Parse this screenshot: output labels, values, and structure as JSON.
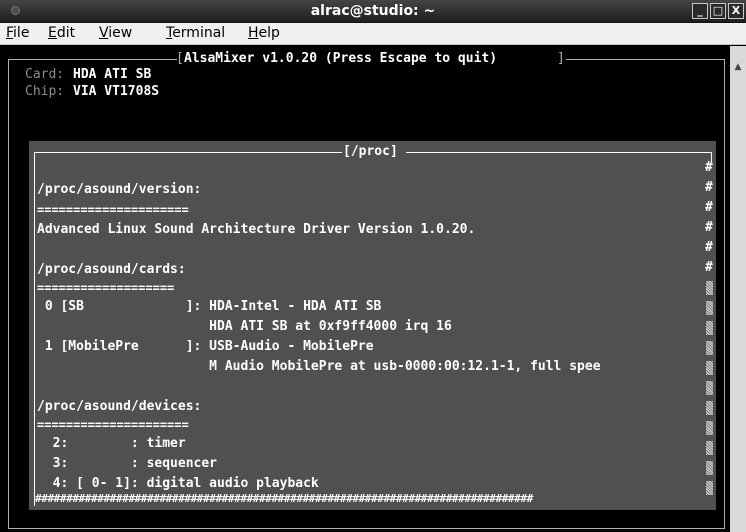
{
  "window": {
    "title": "alrac@studio: ~",
    "minimize": "_",
    "maximize": "□",
    "close": "X"
  },
  "menu": [
    {
      "first": "F",
      "rest": "ile"
    },
    {
      "first": "E",
      "rest": "dit"
    },
    {
      "first": "V",
      "rest": "iew"
    },
    {
      "first": "T",
      "rest": "erminal"
    },
    {
      "first": "H",
      "rest": "elp"
    }
  ],
  "mixer": {
    "header": "AlsaMixer v1.0.20 (Press Escape to quit)",
    "card_label": "Card:",
    "card_value": "HDA ATI SB",
    "chip_label": "Chip:",
    "chip_value": "VIA VT1708S"
  },
  "proc": {
    "title": "[/proc]",
    "lines": [
      "/proc/asound/version:",
      "=====================",
      "Advanced Linux Sound Architecture Driver Version 1.0.20.",
      "",
      "/proc/asound/cards:",
      "===================",
      " 0 [SB             ]: HDA-Intel - HDA ATI SB",
      "                      HDA ATI SB at 0xf9ff4000 irq 16",
      " 1 [MobilePre      ]: USB-Audio - MobilePre",
      "                      M Audio MobilePre at usb-0000:00:12.1-1, full spee",
      "",
      "/proc/asound/devices:",
      "=====================",
      "  2:        : timer",
      "  3:        : sequencer",
      "  4: [ 0- 1]: digital audio playback"
    ],
    "bottom_rule": "################################################################################",
    "scroll_marker": "#"
  },
  "scrollbar": {
    "up_arrow": "▲"
  }
}
